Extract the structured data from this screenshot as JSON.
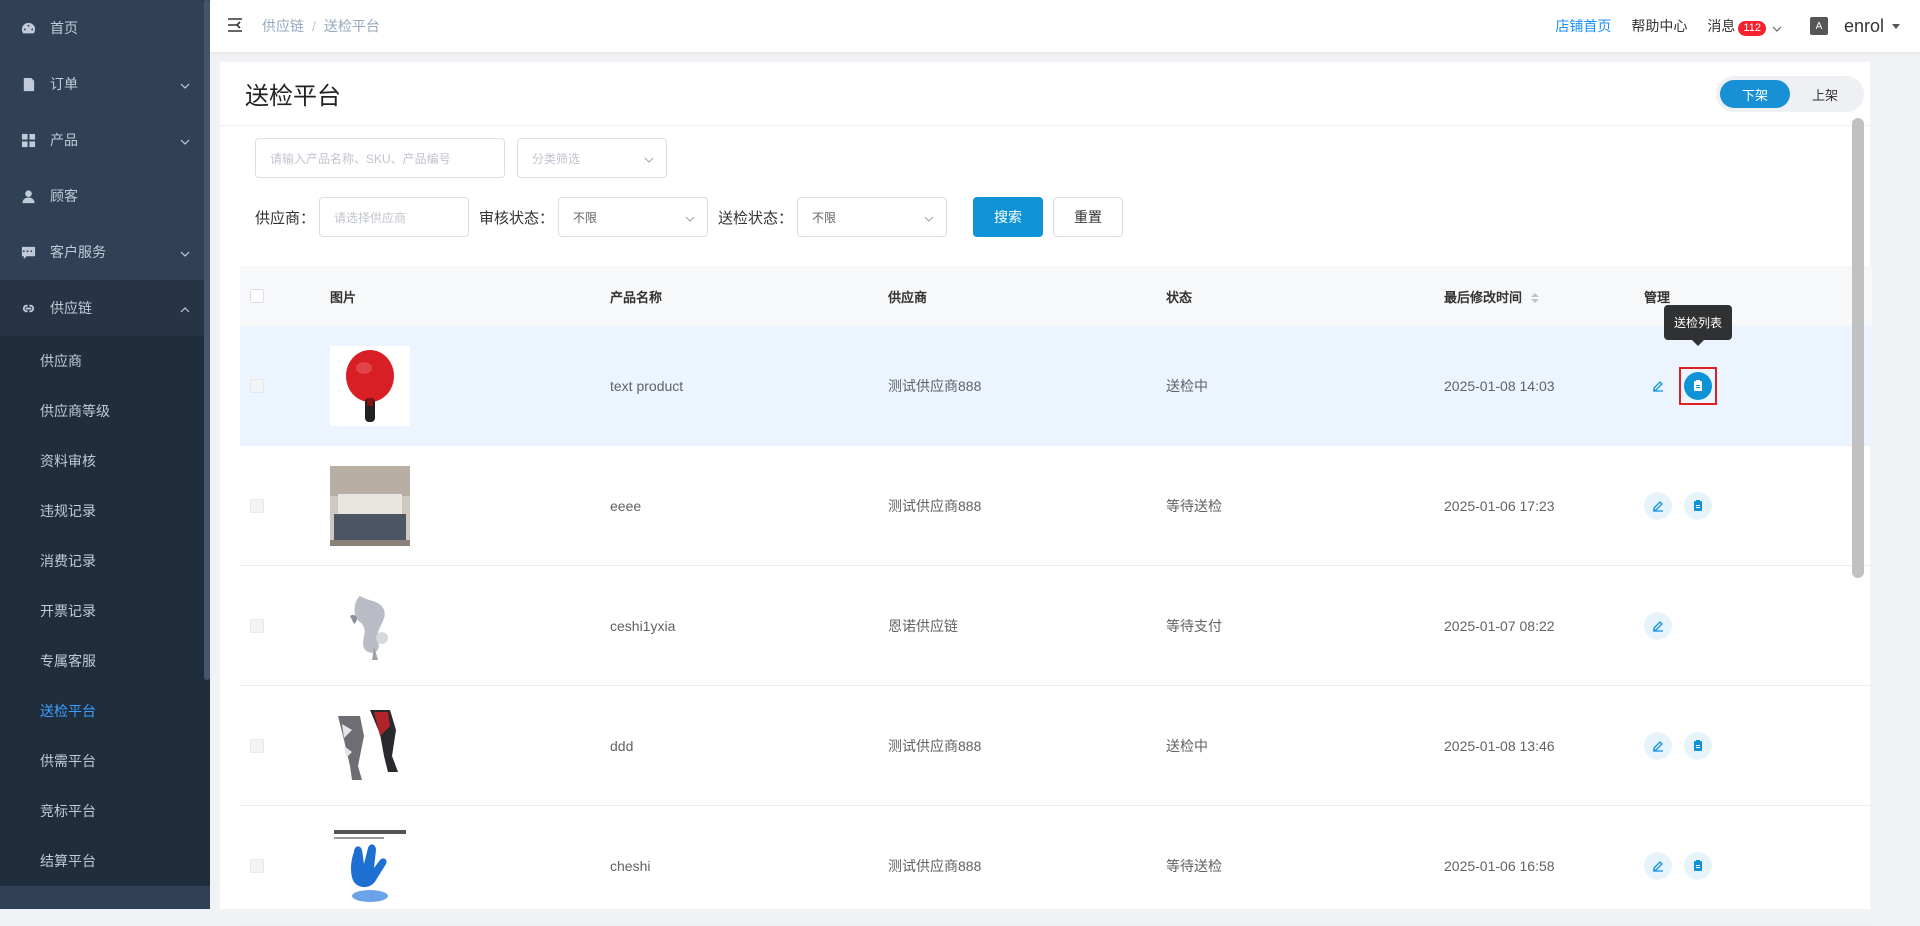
{
  "sidebar": {
    "items": [
      {
        "label": "首页",
        "icon": "dashboard-icon",
        "has_arrow": false
      },
      {
        "label": "订单",
        "icon": "order-icon",
        "has_arrow": true
      },
      {
        "label": "产品",
        "icon": "grid-icon",
        "has_arrow": true
      },
      {
        "label": "顾客",
        "icon": "user-icon",
        "has_arrow": false
      },
      {
        "label": "客户服务",
        "icon": "chat-icon",
        "has_arrow": true
      },
      {
        "label": "供应链",
        "icon": "link-icon",
        "has_arrow": true
      }
    ],
    "subitems": [
      "供应商",
      "供应商等级",
      "资料审核",
      "违规记录",
      "消费记录",
      "开票记录",
      "专属客服",
      "送检平台",
      "供需平台",
      "竞标平台",
      "结算平台"
    ],
    "active_subitem": "送检平台"
  },
  "header": {
    "breadcrumb": [
      "供应链",
      "送检平台"
    ],
    "shop_home": "店铺首页",
    "help": "帮助中心",
    "messages": "消息",
    "message_count": "112",
    "user": "enrol"
  },
  "page": {
    "title": "送检平台",
    "toggle": {
      "off": "下架",
      "on": "上架",
      "selected": "下架"
    }
  },
  "filters": {
    "search_placeholder": "请输入产品名称、SKU、产品编号",
    "category_placeholder": "分类筛选",
    "supplier_label": "供应商：",
    "supplier_placeholder": "请选择供应商",
    "review_label": "审核状态：",
    "review_value": "不限",
    "inspect_label": "送检状态：",
    "inspect_value": "不限",
    "search_button": "搜索",
    "reset_button": "重置"
  },
  "table": {
    "columns": [
      "图片",
      "产品名称",
      "供应商",
      "状态",
      "最后修改时间",
      "管理"
    ],
    "rows": [
      {
        "name": "text product",
        "supplier": "测试供应商888",
        "status": "送检中",
        "time": "2025-01-08 14:03",
        "has_list": true,
        "image": "paddle"
      },
      {
        "name": "eeee",
        "supplier": "测试供应商888",
        "status": "等待送检",
        "time": "2025-01-06 17:23",
        "has_list": true,
        "image": "bed"
      },
      {
        "name": "ceshi1yxia",
        "supplier": "恩诺供应链",
        "status": "等待支付",
        "time": "2025-01-07 08:22",
        "has_list": false,
        "image": "abstract"
      },
      {
        "name": "ddd",
        "supplier": "测试供应商888",
        "status": "送检中",
        "time": "2025-01-08 13:46",
        "has_list": true,
        "image": "leggings"
      },
      {
        "name": "cheshi",
        "supplier": "测试供应商888",
        "status": "等待送检",
        "time": "2025-01-06 16:58",
        "has_list": true,
        "image": "glove"
      }
    ],
    "tooltip": "送检列表"
  },
  "colors": {
    "sidebar_bg": "#304156",
    "primary": "#0e93d6",
    "active_link": "#409eff",
    "badge": "#f5222d"
  }
}
